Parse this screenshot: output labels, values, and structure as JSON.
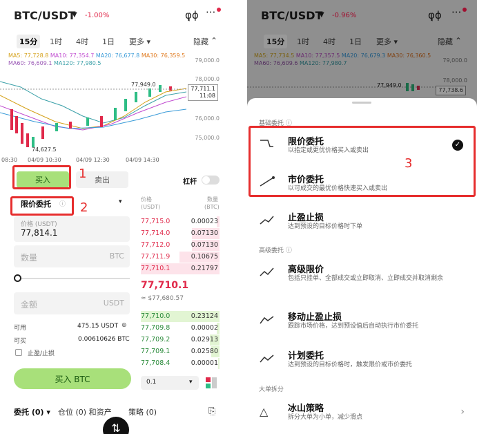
{
  "left": {
    "pair": "BTC/USDT",
    "change": "-1.00%",
    "tabs": [
      "15分",
      "1时",
      "4时",
      "1日",
      "更多 ▾",
      "隐藏"
    ],
    "ma1": {
      "a": "MA5: 77,728.8",
      "b": "MA10: 77,354.7",
      "c": "MA20: 76,677.8",
      "d": "MA30: 76,359.5"
    },
    "ma2": {
      "a": "MA60: 76,609.1",
      "b": "MA120: 77,980.5"
    },
    "yaxis": [
      "79,000.0",
      "78,000.0",
      "76,000.0",
      "75,000.0"
    ],
    "high": "77,949.0",
    "low": "74,627.5",
    "pricebox": {
      "a": "77,711.1",
      "b": "11:08"
    },
    "times": [
      "08:30",
      "04/09 10:30",
      "04/09 12:30",
      "04/09 14:30"
    ],
    "buy": "买入",
    "sell": "卖出",
    "leverage": "杠杆",
    "ordertype": "限价委托",
    "price_label": "价格 (USDT)",
    "price_value": "77,814.1",
    "qty_placeholder": "数量",
    "qty_unit": "BTC",
    "amount_placeholder": "金额",
    "amount_unit": "USDT",
    "avail_label": "可用",
    "avail_value": "475.15 USDT",
    "canbuy_label": "可买",
    "canbuy_value": "0.00610626 BTC",
    "tpsl": "止盈/止损",
    "buy_btc": "买入 BTC",
    "ob_head": {
      "p1": "价格",
      "p2": "(USDT)",
      "q1": "数量",
      "q2": "(BTC)"
    },
    "asks": [
      {
        "p": "77,715.0",
        "q": "0.00023"
      },
      {
        "p": "77,714.0",
        "q": "0.07130"
      },
      {
        "p": "77,712.0",
        "q": "0.07130"
      },
      {
        "p": "77,711.9",
        "q": "0.10675"
      },
      {
        "p": "77,710.1",
        "q": "0.21797"
      }
    ],
    "mid": "77,710.1",
    "mid_sub": "≈ $77,680.57",
    "bids": [
      {
        "p": "77,710.0",
        "q": "0.23124"
      },
      {
        "p": "77,709.8",
        "q": "0.00002"
      },
      {
        "p": "77,709.2",
        "q": "0.02913"
      },
      {
        "p": "77,709.1",
        "q": "0.02580"
      },
      {
        "p": "77,708.4",
        "q": "0.00001"
      }
    ],
    "precision": "0.1",
    "bottom": [
      "委托 (0) ▾",
      "仓位 (0) 和资产",
      "策略 (0)"
    ],
    "n1": "1",
    "n2": "2"
  },
  "right": {
    "pair": "BTC/USDT",
    "change": "-0.96%",
    "tabs": [
      "15分",
      "1时",
      "4时",
      "1日",
      "更多 ▾",
      "隐藏"
    ],
    "ma1": {
      "a": "MA5: 77,734.5",
      "b": "MA10: 77,357.5",
      "c": "MA20: 76,679.3",
      "d": "MA30: 76,360.5"
    },
    "ma2": {
      "a": "MA60: 76,609.6",
      "b": "MA120: 77,980.7"
    },
    "yaxis": [
      "79,000.0",
      "78,000.0"
    ],
    "high": "77,949.0",
    "pricebox": "77,738.6",
    "sec1": "基础委托 ⓘ",
    "sec2": "高级委托 ⓘ",
    "sec3": "大单拆分",
    "items": [
      {
        "t": "限价委托",
        "d": "以指定或更优价格买入或卖出"
      },
      {
        "t": "市价委托",
        "d": "以可成交的最优价格快速买入或卖出"
      },
      {
        "t": "止盈止损",
        "d": "达到预设的目标价格时下单"
      },
      {
        "t": "高级限价",
        "d": "包括只挂单、全部成交或立即取消、立即成交并取消剩余"
      },
      {
        "t": "移动止盈止损",
        "d": "跟踪市场价格，达到预设值后自动执行市价委托"
      },
      {
        "t": "计划委托",
        "d": "达到预设的目标价格时，触发限价或市价委托"
      },
      {
        "t": "冰山策略",
        "d": "拆分大单为小单，减少滑点"
      }
    ],
    "n3": "3"
  },
  "colors": {
    "up": "#2ebd85",
    "down": "#e0294a",
    "red_annot": "#e62d2d"
  }
}
